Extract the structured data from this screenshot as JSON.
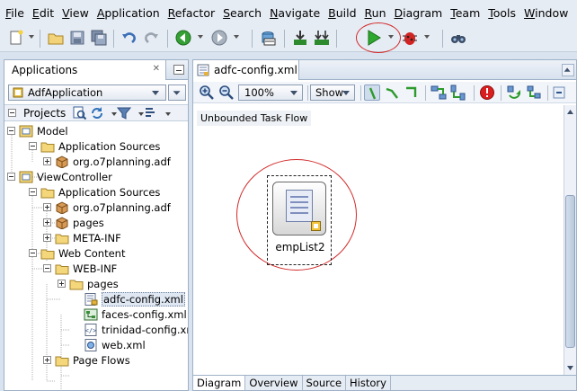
{
  "menubar": {
    "items": [
      "File",
      "Edit",
      "View",
      "Application",
      "Refactor",
      "Search",
      "Navigate",
      "Build",
      "Run",
      "Diagram",
      "Team",
      "Tools",
      "Window"
    ]
  },
  "toolbar": {
    "icons": [
      "new-icon",
      "open-folder-icon",
      "save-icon",
      "save-all-icon",
      "undo-icon",
      "redo-icon",
      "back-icon",
      "forward-icon",
      "sql-worksheet-icon",
      "make-icon",
      "rebuild-icon",
      "run-icon",
      "debug-icon",
      "binoculars-icon"
    ]
  },
  "applications_panel": {
    "tab_label": "Applications",
    "app_selector": "AdfApplication",
    "projects_label": "Projects"
  },
  "tree": {
    "nodes": [
      {
        "label": "Model",
        "icon": "project-icon",
        "expander": "minus"
      },
      {
        "label": "Application Sources",
        "icon": "folder-icon",
        "expander": "minus"
      },
      {
        "label": "org.o7planning.adf",
        "icon": "package-icon",
        "expander": "plus"
      },
      {
        "label": "ViewController",
        "icon": "project-icon",
        "expander": "minus"
      },
      {
        "label": "Application Sources",
        "icon": "folder-icon",
        "expander": "minus"
      },
      {
        "label": "org.o7planning.adf",
        "icon": "package-icon",
        "expander": "plus"
      },
      {
        "label": "pages",
        "icon": "package-icon",
        "expander": "plus"
      },
      {
        "label": "META-INF",
        "icon": "folder-icon",
        "expander": "plus"
      },
      {
        "label": "Web Content",
        "icon": "folder-icon",
        "expander": "minus"
      },
      {
        "label": "WEB-INF",
        "icon": "folder-icon",
        "expander": "minus"
      },
      {
        "label": "pages",
        "icon": "folder-icon",
        "expander": "plus"
      },
      {
        "label": "adfc-config.xml",
        "icon": "taskflow-file-icon",
        "expander": "none",
        "selected": true
      },
      {
        "label": "faces-config.xml",
        "icon": "faces-config-icon",
        "expander": "none"
      },
      {
        "label": "trinidad-config.xml",
        "icon": "xml-file-icon",
        "expander": "none"
      },
      {
        "label": "web.xml",
        "icon": "web-xml-icon",
        "expander": "none"
      },
      {
        "label": "Page Flows",
        "icon": "folder-icon",
        "expander": "plus"
      }
    ]
  },
  "editor": {
    "file_tab": "adfc-config.xml",
    "zoom": "100%",
    "show_label": "Show",
    "flow_label": "Unbounded Task Flow",
    "activity_name": "empList2",
    "bottom_tabs": [
      "Diagram",
      "Overview",
      "Source",
      "History"
    ],
    "active_bottom_tab": "Diagram"
  },
  "colors": {
    "highlight_circle": "#d22a2a",
    "run_green": "#2fa82f",
    "panel_bg": "#d8e3ef"
  }
}
